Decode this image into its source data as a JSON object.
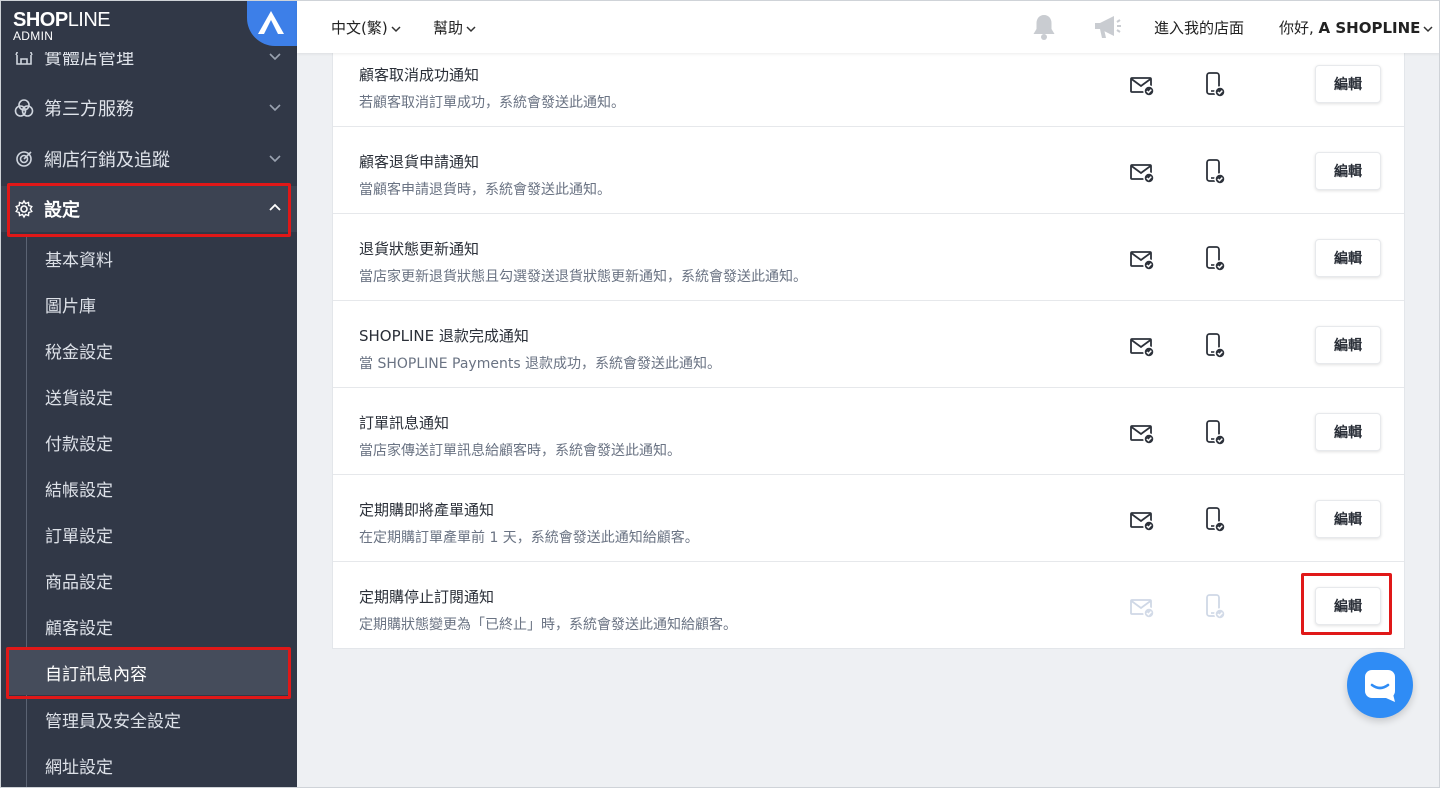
{
  "logo": {
    "name_bold": "SHOP",
    "name_light": "LINE",
    "sub": "ADMIN"
  },
  "sidebar": {
    "items": [
      {
        "label": "實體店管理",
        "icon": "store-icon"
      },
      {
        "label": "第三方服務",
        "icon": "circles-icon"
      },
      {
        "label": "網店行銷及追蹤",
        "icon": "target-icon"
      },
      {
        "label": "設定",
        "icon": "gear-icon"
      }
    ],
    "sub_items": [
      {
        "label": "基本資料"
      },
      {
        "label": "圖片庫"
      },
      {
        "label": "稅金設定"
      },
      {
        "label": "送貨設定"
      },
      {
        "label": "付款設定"
      },
      {
        "label": "結帳設定"
      },
      {
        "label": "訂單設定"
      },
      {
        "label": "商品設定"
      },
      {
        "label": "顧客設定"
      },
      {
        "label": "自訂訊息內容"
      },
      {
        "label": "管理員及安全設定"
      },
      {
        "label": "網址設定"
      }
    ]
  },
  "topbar": {
    "language": "中文(繁)",
    "help": "幫助",
    "store": "進入我的店面",
    "greeting": "你好, ",
    "user": "A SHOPLINE"
  },
  "notifications": [
    {
      "title": "顧客取消成功通知",
      "desc": "若顧客取消訂單成功，系統會發送此通知。",
      "enabled": true
    },
    {
      "title": "顧客退貨申請通知",
      "desc": "當顧客申請退貨時，系統會發送此通知。",
      "enabled": true
    },
    {
      "title": "退貨狀態更新通知",
      "desc": "當店家更新退貨狀態且勾選發送退貨狀態更新通知，系統會發送此通知。",
      "enabled": true
    },
    {
      "title": "SHOPLINE 退款完成通知",
      "desc": "當 SHOPLINE Payments 退款成功，系統會發送此通知。",
      "enabled": true
    },
    {
      "title": "訂單訊息通知",
      "desc": "當店家傳送訂單訊息給顧客時，系統會發送此通知。",
      "enabled": true
    },
    {
      "title": "定期購即將產單通知",
      "desc": "在定期購訂單產單前 1 天，系統會發送此通知給顧客。",
      "enabled": true
    },
    {
      "title": "定期購停止訂閱通知",
      "desc": "定期購狀態變更為「已終止」時，系統會發送此通知給顧客。",
      "enabled": false
    }
  ],
  "edit_label": "編輯",
  "colors": {
    "sidebar": "#313847",
    "accent": "#2f8cf5",
    "highlight": "#e01818"
  }
}
